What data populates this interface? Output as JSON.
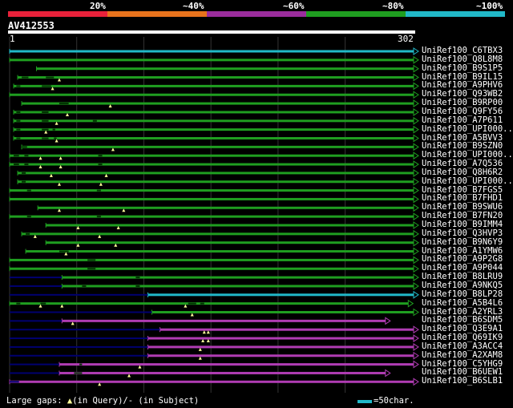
{
  "identity_scale": [
    {
      "label": "20%",
      "color": "#e8213a"
    },
    {
      "label": "~40%",
      "color": "#e8731c"
    },
    {
      "label": "~60%",
      "color": "#9b2d9d"
    },
    {
      "label": "~80%",
      "color": "#1f9e20"
    },
    {
      "label": "~100%",
      "color": "#21b8c8"
    }
  ],
  "query": {
    "name": "AV412553",
    "start": "1",
    "end": "302",
    "length": 302
  },
  "colors": {
    "green": "#1f9e20",
    "cyan": "#21b8c8",
    "purple": "#b03cb3",
    "gap": "#000070",
    "marker": "#ffff99",
    "grid": "#333333"
  },
  "hits": [
    {
      "label": "UniRef100_C6TBX3",
      "color": "cyan",
      "start": 1,
      "end": 302,
      "gaps": [],
      "markers": []
    },
    {
      "label": "UniRef100_Q8L8M8",
      "color": "green",
      "start": 1,
      "end": 302,
      "gaps": [],
      "markers": []
    },
    {
      "label": "UniRef100_B9S1P5",
      "color": "green",
      "start": 21,
      "end": 302,
      "gaps": [],
      "markers": []
    },
    {
      "label": "UniRef100_B9IL15",
      "color": "green",
      "start": 7,
      "end": 302,
      "gaps": [
        [
          10,
          15
        ],
        [
          28,
          34
        ]
      ],
      "markers": [
        38
      ]
    },
    {
      "label": "UniRef100_A9PHV6",
      "color": "green",
      "start": 4,
      "end": 302,
      "gaps": [
        [
          6,
          9
        ],
        [
          25,
          32
        ]
      ],
      "markers": [
        33
      ]
    },
    {
      "label": "UniRef100_Q93WB2",
      "color": "green",
      "start": 1,
      "end": 302,
      "gaps": [],
      "markers": []
    },
    {
      "label": "UniRef100_B9RP00",
      "color": "green",
      "start": 10,
      "end": 302,
      "gaps": [
        [
          38,
          45
        ]
      ],
      "markers": [
        76
      ]
    },
    {
      "label": "UniRef100_Q9FY56",
      "color": "green",
      "start": 4,
      "end": 302,
      "gaps": [
        [
          6,
          9
        ],
        [
          25,
          30
        ]
      ],
      "markers": [
        44
      ]
    },
    {
      "label": "UniRef100_A7P611",
      "color": "green",
      "start": 4,
      "end": 302,
      "gaps": [
        [
          6,
          9
        ],
        [
          25,
          30
        ],
        [
          63,
          66
        ]
      ],
      "markers": [
        36
      ]
    },
    {
      "label": "UniRef100_UPI000..",
      "color": "green",
      "start": 4,
      "end": 302,
      "gaps": [
        [
          6,
          9
        ],
        [
          25,
          30
        ],
        [
          33,
          35
        ]
      ],
      "markers": [
        28
      ]
    },
    {
      "label": "UniRef100_A5BVV3",
      "color": "green",
      "start": 4,
      "end": 302,
      "gaps": [
        [
          6,
          9
        ],
        [
          25,
          30
        ],
        [
          34,
          36
        ]
      ],
      "markers": [
        36
      ]
    },
    {
      "label": "UniRef100_B9SZN0",
      "color": "green",
      "start": 10,
      "end": 302,
      "gaps": [
        [
          10,
          14
        ]
      ],
      "markers": [
        78
      ]
    },
    {
      "label": "UniRef100_UPI000..",
      "color": "green",
      "start": 1,
      "end": 302,
      "gaps": [
        [
          4,
          8
        ],
        [
          12,
          15
        ],
        [
          67,
          70
        ]
      ],
      "markers": [
        24,
        39
      ]
    },
    {
      "label": "UniRef100_A7Q536",
      "color": "green",
      "start": 1,
      "end": 302,
      "gaps": [
        [
          4,
          8
        ],
        [
          12,
          15
        ],
        [
          67,
          70
        ]
      ],
      "markers": [
        24,
        39
      ]
    },
    {
      "label": "UniRef100_Q8H6R2",
      "color": "green",
      "start": 7,
      "end": 302,
      "gaps": [
        [
          10,
          13
        ]
      ],
      "markers": [
        32,
        73
      ]
    },
    {
      "label": "UniRef100_UPI000..",
      "color": "green",
      "start": 7,
      "end": 302,
      "gaps": [
        [
          10,
          13
        ]
      ],
      "markers": [
        38,
        69
      ]
    },
    {
      "label": "UniRef100_B7FGS5",
      "color": "green",
      "start": 1,
      "end": 302,
      "gaps": [
        [
          14,
          17
        ],
        [
          66,
          69
        ]
      ],
      "markers": []
    },
    {
      "label": "UniRef100_B7FHD1",
      "color": "green",
      "start": 1,
      "end": 302,
      "gaps": [],
      "markers": []
    },
    {
      "label": "UniRef100_B9SWU6",
      "color": "green",
      "start": 22,
      "end": 302,
      "gaps": [],
      "markers": [
        38,
        86
      ]
    },
    {
      "label": "UniRef100_B7FN20",
      "color": "green",
      "start": 1,
      "end": 302,
      "gaps": [
        [
          14,
          17
        ],
        [
          66,
          69
        ]
      ],
      "markers": []
    },
    {
      "label": "UniRef100_B9IMM4",
      "color": "green",
      "start": 28,
      "end": 302,
      "gaps": [],
      "markers": [
        52,
        82
      ]
    },
    {
      "label": "UniRef100_Q3HVP3",
      "color": "green",
      "start": 10,
      "end": 302,
      "gaps": [
        [
          13,
          16
        ]
      ],
      "markers": [
        20,
        68
      ]
    },
    {
      "label": "UniRef100_B9N6Y9",
      "color": "green",
      "start": 28,
      "end": 302,
      "gaps": [],
      "markers": [
        52,
        80
      ]
    },
    {
      "label": "UniRef100_A1YMW6",
      "color": "green",
      "start": 13,
      "end": 302,
      "gaps": [
        [
          38,
          45
        ]
      ],
      "markers": [
        43
      ]
    },
    {
      "label": "UniRef100_A9P2G8",
      "color": "green",
      "start": 1,
      "end": 302,
      "gaps": [
        [
          59,
          65
        ]
      ],
      "markers": []
    },
    {
      "label": "UniRef100_A9P044",
      "color": "green",
      "start": 1,
      "end": 302,
      "gaps": [
        [
          59,
          65
        ]
      ],
      "markers": []
    },
    {
      "label": "UniRef100_B8LRU9",
      "color": "green",
      "start": 40,
      "end": 302,
      "gaps": [
        [
          1,
          40
        ],
        [
          95,
          98
        ]
      ],
      "markers": []
    },
    {
      "label": "UniRef100_A9NKQ5",
      "color": "green",
      "start": 40,
      "end": 302,
      "gaps": [
        [
          1,
          40
        ],
        [
          55,
          58
        ],
        [
          95,
          98
        ]
      ],
      "markers": []
    },
    {
      "label": "UniRef100_B8LP28",
      "color": "cyan",
      "start": 104,
      "end": 302,
      "gaps": [
        [
          1,
          104
        ]
      ],
      "markers": []
    },
    {
      "label": "UniRef100_A5B4L6",
      "color": "green",
      "start": 1,
      "end": 298,
      "gaps": [
        [
          6,
          9
        ],
        [
          24,
          28
        ],
        [
          134,
          140
        ],
        [
          143,
          146
        ]
      ],
      "markers": [
        24,
        40,
        132
      ]
    },
    {
      "label": "UniRef100_A2YRL3",
      "color": "green",
      "start": 107,
      "end": 302,
      "gaps": [
        [
          1,
          107
        ]
      ],
      "markers": [
        137
      ]
    },
    {
      "label": "UniRef100_B6SDM5",
      "color": "purple",
      "start": 40,
      "end": 281,
      "gaps": [
        [
          1,
          40
        ]
      ],
      "markers": [
        48
      ]
    },
    {
      "label": "UniRef100_Q3E9A1",
      "color": "purple",
      "start": 113,
      "end": 302,
      "gaps": [
        [
          1,
          113
        ]
      ],
      "markers": [
        146,
        149
      ]
    },
    {
      "label": "UniRef100_Q69IK9",
      "color": "purple",
      "start": 104,
      "end": 302,
      "gaps": [
        [
          1,
          104
        ]
      ],
      "markers": [
        145,
        149
      ]
    },
    {
      "label": "UniRef100_A3ACC4",
      "color": "purple",
      "start": 104,
      "end": 302,
      "gaps": [
        [
          1,
          104
        ]
      ],
      "markers": [
        143
      ]
    },
    {
      "label": "UniRef100_A2XAM8",
      "color": "purple",
      "start": 104,
      "end": 302,
      "gaps": [
        [
          1,
          104
        ]
      ],
      "markers": [
        143
      ]
    },
    {
      "label": "UniRef100_C5YHG9",
      "color": "purple",
      "start": 38,
      "end": 302,
      "gaps": [
        [
          1,
          38
        ],
        [
          53,
          55
        ]
      ],
      "markers": [
        98
      ]
    },
    {
      "label": "UniRef100_B6UEW1",
      "color": "purple",
      "start": 38,
      "end": 281,
      "gaps": [
        [
          1,
          38
        ],
        [
          49,
          55
        ]
      ],
      "markers": [
        90
      ]
    },
    {
      "label": "UniRef100_B6SLB1",
      "color": "purple",
      "start": 1,
      "end": 302,
      "gaps": [
        [
          1,
          8
        ]
      ],
      "markers": [
        68
      ]
    }
  ],
  "legend": {
    "prefix": "Large gaps:",
    "query_text": "(in Query)/",
    "subject_text": "- (in Subject)",
    "scale_text": "=50char."
  }
}
